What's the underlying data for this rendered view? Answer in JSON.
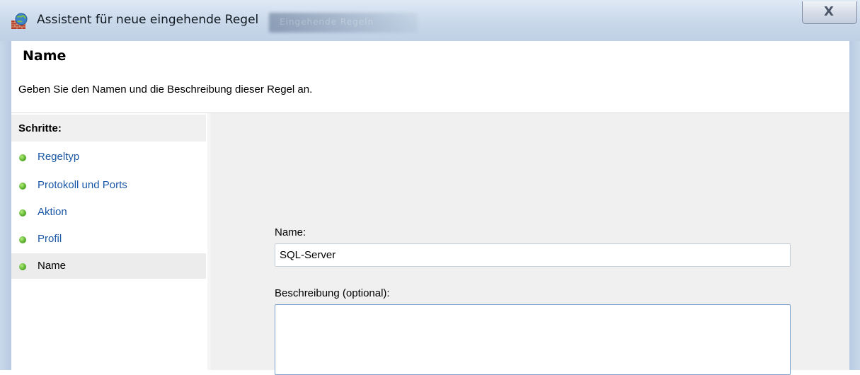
{
  "window": {
    "title": "Assistent für neue eingehende Regel",
    "background_title": "Eingehende Regeln",
    "close_glyph": "X",
    "icon": "firewall-icon"
  },
  "header": {
    "title": "Name",
    "subtitle": "Geben Sie den Namen und die Beschreibung dieser Regel an."
  },
  "steps": {
    "heading": "Schritte:",
    "items": [
      {
        "label": "Regeltyp",
        "active": false
      },
      {
        "label": "Protokoll und Ports",
        "active": false
      },
      {
        "label": "Aktion",
        "active": false
      },
      {
        "label": "Profil",
        "active": false
      },
      {
        "label": "Name",
        "active": true
      }
    ]
  },
  "form": {
    "name_label": "Name:",
    "name_value": "SQL-Server",
    "description_label": "Beschreibung (optional):",
    "description_value": ""
  },
  "colors": {
    "link": "#1a57a6",
    "step_dot": "#5fb431",
    "panel_bg": "#f0f0f0",
    "frame": "#c9d8ea"
  }
}
